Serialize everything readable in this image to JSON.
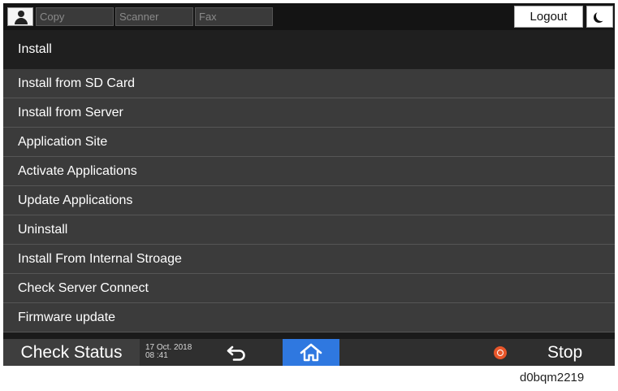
{
  "topbar": {
    "tabs": [
      {
        "label": "Copy"
      },
      {
        "label": "Scanner"
      },
      {
        "label": "Fax"
      }
    ],
    "logout_label": "Logout",
    "icons": {
      "user": "user-icon",
      "moon": "moon-icon"
    }
  },
  "section": {
    "title": "Install"
  },
  "menu": {
    "items": [
      {
        "label": "Install from SD Card"
      },
      {
        "label": "Install from Server"
      },
      {
        "label": "Application Site"
      },
      {
        "label": "Activate Applications"
      },
      {
        "label": "Update Applications"
      },
      {
        "label": "Uninstall"
      },
      {
        "label": "Install From Internal Stroage"
      },
      {
        "label": "Check Server Connect"
      },
      {
        "label": "Firmware update"
      }
    ]
  },
  "bottombar": {
    "check_status_label": "Check Status",
    "date": "17 Oct. 2018",
    "time": "08 :41",
    "stop_label": "Stop",
    "icons": {
      "back": "back-arrow-icon",
      "home": "home-icon",
      "stop": "stop-icon"
    }
  },
  "caption": "d0bqm2219",
  "colors": {
    "home_accent": "#2f78e0",
    "stop_accent": "#e8562a"
  }
}
